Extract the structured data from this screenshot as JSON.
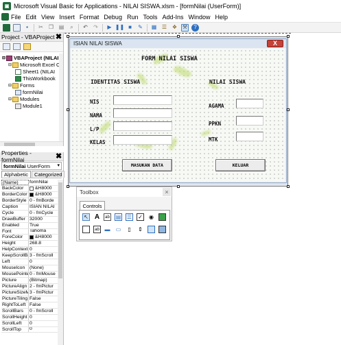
{
  "app": {
    "title": "Microsoft Visual Basic for Applications - NILAI SISWA.xlsm - [formNilai (UserForm)]",
    "menu": [
      "File",
      "Edit",
      "View",
      "Insert",
      "Format",
      "Debug",
      "Run",
      "Tools",
      "Add-Ins",
      "Window",
      "Help"
    ]
  },
  "project": {
    "header": "Project - VBAProject",
    "close": "✖",
    "tree": [
      {
        "label": "VBAProject (NILAI S",
        "icon": "proj"
      },
      {
        "label": "Microsoft Excel Ob",
        "icon": "folder"
      },
      {
        "label": "Sheet1 (NILAI",
        "icon": "sheet"
      },
      {
        "label": "ThisWorkbook",
        "icon": "xl"
      },
      {
        "label": "Forms",
        "icon": "folder"
      },
      {
        "label": "formNilai",
        "icon": "form"
      },
      {
        "label": "Modules",
        "icon": "folder"
      },
      {
        "label": "Module1",
        "icon": "mod"
      }
    ]
  },
  "properties": {
    "header": "Properties - formNilai",
    "close": "✖",
    "object_name": "formNilai",
    "object_type": "UserForm",
    "tabs": [
      "Alphabetic",
      "Categorized"
    ],
    "rows": [
      {
        "name": "(Name)",
        "value": "formNilai"
      },
      {
        "name": "BackColor",
        "value": "&H8000",
        "swatch": "#ffffff"
      },
      {
        "name": "BorderColor",
        "value": "&H8000",
        "swatch": "#000000"
      },
      {
        "name": "BorderStyle",
        "value": "0 - fmBorde"
      },
      {
        "name": "Caption",
        "value": "ISIAN NILAI"
      },
      {
        "name": "Cycle",
        "value": "0 - fmCycle"
      },
      {
        "name": "DrawBuffer",
        "value": "32000"
      },
      {
        "name": "Enabled",
        "value": "True"
      },
      {
        "name": "Font",
        "value": "Tahoma"
      },
      {
        "name": "ForeColor",
        "value": "&H8000",
        "swatch": "#000000"
      },
      {
        "name": "Height",
        "value": "268.8"
      },
      {
        "name": "HelpContextI",
        "value": "0"
      },
      {
        "name": "KeepScrollBa",
        "value": "3 - fmScroll"
      },
      {
        "name": "Left",
        "value": "0"
      },
      {
        "name": "MouseIcon",
        "value": "(None)"
      },
      {
        "name": "MousePointe",
        "value": "0 - fmMouse"
      },
      {
        "name": "Picture",
        "value": "(Bitmap)"
      },
      {
        "name": "PictureAlign",
        "value": "2 - fmPictur"
      },
      {
        "name": "PictureSizeM",
        "value": "3 - fmPictur"
      },
      {
        "name": "PictureTiling",
        "value": "False"
      },
      {
        "name": "RightToLeft",
        "value": "False"
      },
      {
        "name": "ScrollBars",
        "value": "0 - fmScroll"
      },
      {
        "name": "ScrollHeight",
        "value": "0"
      },
      {
        "name": "ScrollLeft",
        "value": "0"
      },
      {
        "name": "ScrollTop",
        "value": "0"
      }
    ]
  },
  "form": {
    "caption": "ISIAN NILAI SISWA",
    "close": "X",
    "title": "FORM NILAI SISWA",
    "section_identity": "IDENTITAS SISWA",
    "section_grades": "NILAI SISWA",
    "labels": {
      "nis": "NIS",
      "nama": "NAMA",
      "lp": "L/P",
      "kelas": "KELAS",
      "agama": "AGAMA",
      "ppkn": "PPKN",
      "mtk": "MTK"
    },
    "buttons": {
      "submit": "MASUKAN DATA",
      "exit": "KELUAR"
    }
  },
  "toolbox": {
    "title": "Toolbox",
    "close": "×",
    "tab": "Controls"
  }
}
